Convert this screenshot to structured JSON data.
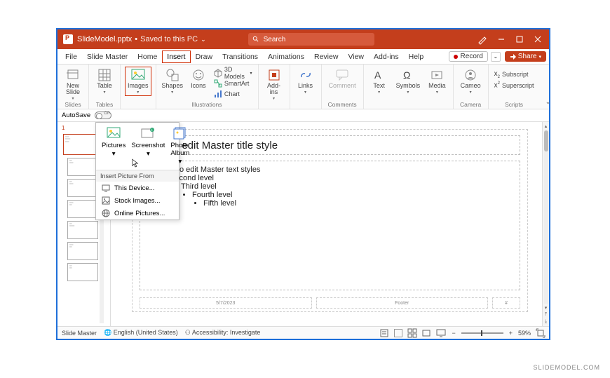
{
  "title": {
    "filename": "SlideModel.pptx",
    "saved": "Saved to this PC",
    "search_placeholder": "Search"
  },
  "tabs": [
    "File",
    "Slide Master",
    "Home",
    "Insert",
    "Draw",
    "Transitions",
    "Animations",
    "Review",
    "View",
    "Add-ins",
    "Help"
  ],
  "active_tab": "Insert",
  "record_label": "Record",
  "share_label": "Share",
  "ribbon": {
    "new_slide": "New\nSlide",
    "tables": "Tables",
    "images": "Images",
    "shapes": "Shapes",
    "icons": "Icons",
    "models": "3D Models",
    "smartart": "SmartArt",
    "chart": "Chart",
    "illustrations": "Illustrations",
    "addins": "Add-\nins",
    "links": "Links",
    "comment": "Comment",
    "comments": "Comments",
    "text": "Text",
    "symbols": "Symbols",
    "media": "Media",
    "cameo": "Cameo",
    "camera": "Camera",
    "subscript": "Subscript",
    "superscript": "Superscript",
    "scripts": "Scripts",
    "slides": "Slides",
    "table": "Table"
  },
  "autosave": {
    "label": "AutoSave",
    "state": "Off"
  },
  "images_dropdown": {
    "pictures": "Pictures",
    "screenshot": "Screenshot",
    "photo_album": "Photo\nAlbum",
    "header": "Insert Picture From",
    "device": "This Device...",
    "stock": "Stock Images...",
    "online": "Online Pictures..."
  },
  "slide": {
    "title": "Click to edit Master title style",
    "l1": "Click to edit Master text styles",
    "l2": "Second level",
    "l3": "Third level",
    "l4": "Fourth level",
    "l5": "Fifth level",
    "date": "5/7/2023",
    "footer": "Footer",
    "num": "#"
  },
  "status": {
    "mode": "Slide Master",
    "lang": "English (United States)",
    "access": "Accessibility: Investigate",
    "zoom": "59%"
  },
  "watermark": "SLIDEMODEL.COM"
}
